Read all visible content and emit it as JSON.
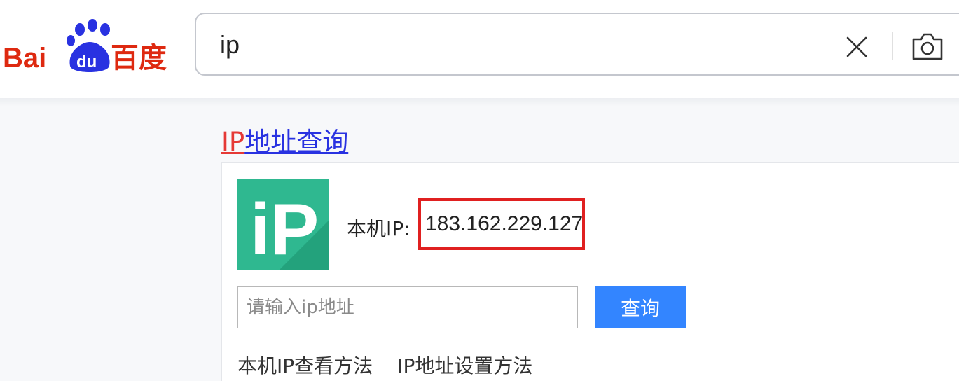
{
  "header": {
    "logo": {
      "text_latin": "Bai",
      "text_du": "du",
      "text_cn": "百度",
      "brand_color": "#de2910",
      "paw_color": "#2932e1"
    },
    "search": {
      "value": "ip",
      "placeholder": ""
    },
    "icons": {
      "clear": "close-icon",
      "camera": "camera-icon"
    }
  },
  "result": {
    "title_highlight": "IP",
    "title_rest": "地址查询",
    "title_color": "#2932e1",
    "highlight_color": "#e53935",
    "ip_logo_text": "iP",
    "ip_logo_color": "#2fb890",
    "local_ip_label": "本机IP:",
    "local_ip_value": "183.162.229.127",
    "query_placeholder": "请输入ip地址",
    "query_button": "查询",
    "links": [
      "本机IP查看方法",
      "IP地址设置方法"
    ]
  }
}
